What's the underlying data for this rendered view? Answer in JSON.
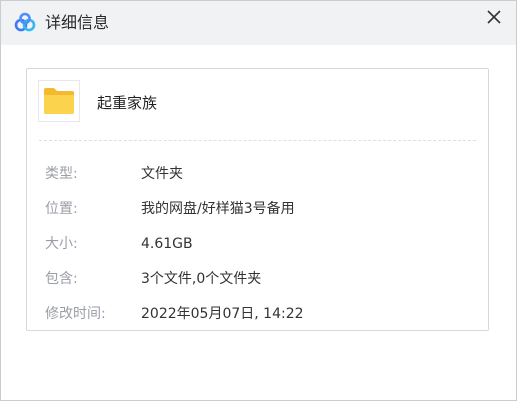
{
  "window": {
    "title": "详细信息",
    "app_icon": "baidu-netdisk-logo-icon",
    "close_icon": "close-icon"
  },
  "item": {
    "icon": "folder-icon",
    "name": "起重家族"
  },
  "details": [
    {
      "label": "类型:",
      "value": "文件夹"
    },
    {
      "label": "位置:",
      "value": "我的网盘/好样猫3号备用"
    },
    {
      "label": "大小:",
      "value": "4.61GB"
    },
    {
      "label": "包含:",
      "value": "3个文件,0个文件夹"
    },
    {
      "label": "修改时间:",
      "value": "2022年05月07日, 14:22"
    }
  ],
  "colors": {
    "titlebar_bg": "#f1f2f4",
    "folder_yellow": "#f7c843",
    "logo_blue": "#3b7cf6",
    "label_gray": "#9a9ea5",
    "value_text": "#333333"
  }
}
